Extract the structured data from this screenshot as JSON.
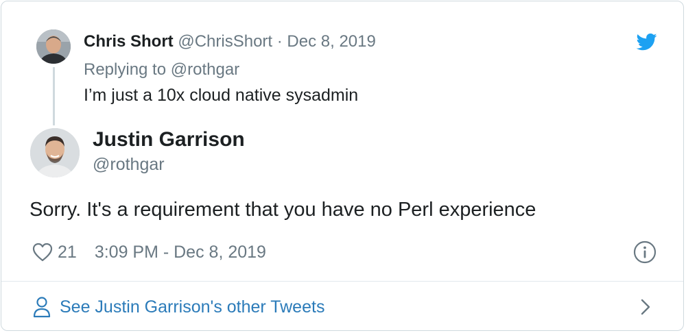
{
  "parent_tweet": {
    "name": "Chris Short",
    "handle": "@ChrisShort",
    "separator": " · ",
    "date": "Dec 8, 2019",
    "replying_prefix": "Replying to ",
    "replying_handle": "@rothgar",
    "text": "I’m just a 10x cloud native sysadmin"
  },
  "main_tweet": {
    "name": "Justin Garrison",
    "handle": "@rothgar",
    "text": "Sorry. It's a requirement that you have no Perl experience",
    "likes": "21",
    "timestamp": "3:09 PM - Dec 8, 2019"
  },
  "footer": {
    "link_text": "See Justin Garrison's other Tweets"
  },
  "icons": {
    "brand": "twitter-bird-icon",
    "like": "heart-icon",
    "info": "info-icon",
    "profile": "person-icon",
    "more": "chevron-right-icon"
  },
  "colors": {
    "brand_blue": "#1da1f2",
    "link_blue": "#2b7bb9",
    "secondary_text": "#697882",
    "primary_text": "#1c2022",
    "border": "#cfd9de"
  }
}
